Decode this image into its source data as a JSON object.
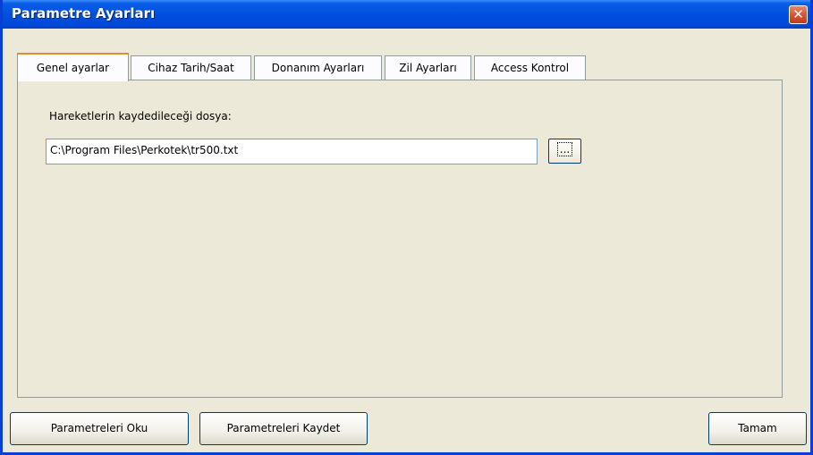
{
  "window": {
    "title": "Parametre Ayarları",
    "close_label": "✕"
  },
  "tabs": [
    {
      "label": "Genel ayarlar"
    },
    {
      "label": "Cihaz Tarih/Saat"
    },
    {
      "label": "Donanım Ayarları"
    },
    {
      "label": "Zil Ayarları"
    },
    {
      "label": "Access Kontrol"
    }
  ],
  "general": {
    "file_label": "Hareketlerin kaydedileceği dosya:",
    "file_path": "C:\\Program Files\\Perkotek\\tr500.txt",
    "browse_label": "..."
  },
  "footer": {
    "read_label": "Parametreleri Oku",
    "save_label": "Parametreleri Kaydet",
    "ok_label": "Tamam"
  }
}
